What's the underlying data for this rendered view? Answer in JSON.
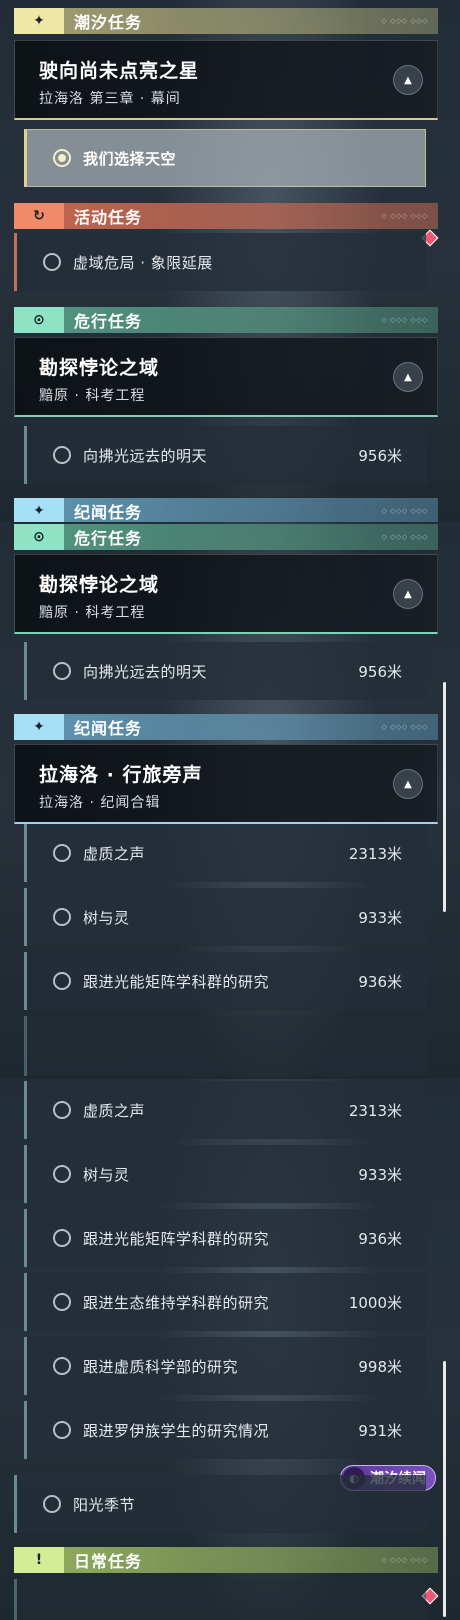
{
  "categories": {
    "tide": {
      "label": "潮汐任务",
      "badge_icon": "✦"
    },
    "activity": {
      "label": "活动任务",
      "badge_icon": "↻"
    },
    "danger": {
      "label": "危行任务",
      "badge_icon": "⊙"
    },
    "chronicle": {
      "label": "纪闻任务",
      "badge_icon": "✦"
    },
    "daily": {
      "label": "日常任务",
      "badge_icon": "!"
    }
  },
  "cards": {
    "star": {
      "title": "驶向尚未点亮之星",
      "subtitle": "拉海洛 第三章 · 幕间"
    },
    "domain": {
      "title": "勘探悖论之域",
      "subtitle": "黯原 · 科考工程"
    },
    "lahailuo": {
      "title": "拉海洛 · 行旅旁声",
      "subtitle": "拉海洛 · 纪闻合辑"
    }
  },
  "quests": {
    "choose_sky": {
      "name": "我们选择天空"
    },
    "void_crisis": {
      "name": "虚域危局 · 象限延展"
    },
    "toward_light": {
      "name": "向拂光远去的明天",
      "distance": "956米"
    },
    "void_voice": {
      "name": "虚质之声",
      "distance": "2313米"
    },
    "tree_spirit": {
      "name": "树与灵",
      "distance": "933米"
    },
    "follow_optical": {
      "name": "跟进光能矩阵学科群的研究",
      "distance": "936米"
    },
    "follow_ecology": {
      "name": "跟进生态维持学科群的研究",
      "distance": "1000米"
    },
    "follow_void_science": {
      "name": "跟进虚质科学部的研究",
      "distance": "998米"
    },
    "follow_roi": {
      "name": "跟进罗伊族学生的研究情况",
      "distance": "931米"
    },
    "sunshine": {
      "name": "阳光季节"
    }
  },
  "tide_tag": {
    "label": "潮汐续闻",
    "icon": "tide-icon"
  },
  "colors": {
    "tide": "#efe7a8",
    "activity": "#f08a6a",
    "danger": "#8de3c3",
    "chronicle": "#a5e0f6",
    "daily": "#d4ec95",
    "gem": "#e85b76",
    "tag": "#7b4fbf"
  }
}
